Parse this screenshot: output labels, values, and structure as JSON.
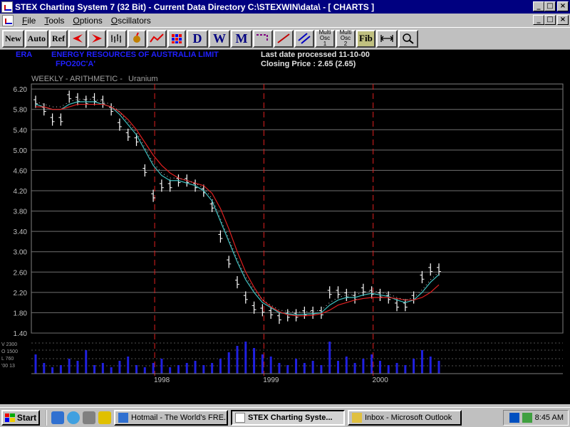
{
  "window": {
    "title": "STEX Charting System 7 (32 Bit)  -  Current Data Directory C:\\STEXWIN\\data\\ - [  CHARTS    ]",
    "min": "_",
    "max": "□",
    "close": "×"
  },
  "menu": [
    "File",
    "Tools",
    "Options",
    "Oscillators"
  ],
  "toolbar": {
    "new": "New",
    "auto": "Auto",
    "ref": "Ref",
    "d": "D",
    "w": "W",
    "m": "M",
    "multi1": "Multi Osc 1",
    "multi2": "Multi Osc 2",
    "fib": "Fib"
  },
  "header": {
    "code": "ERA",
    "company": "ENERGY RESOURCES OF AUSTRALIA LIMIT",
    "subcode": "FPO20C'A'",
    "last_date": "Last date processed 11-10-00",
    "closing": "Closing Price : 2.65  (2.65)",
    "mode": "WEEKLY - ARITHMETIC -",
    "sector": "Uranium"
  },
  "chart_data": {
    "type": "line",
    "title": "",
    "ylim": [
      1.4,
      6.3
    ],
    "yticks": [
      "6.20",
      "5.80",
      "5.40",
      "5.00",
      "4.60",
      "4.20",
      "3.80",
      "3.40",
      "3.00",
      "2.60",
      "2.20",
      "1.80",
      "1.40"
    ],
    "xticks": [
      "1998",
      "1999",
      "2000"
    ],
    "volume_labels": [
      "V 2300",
      "O 1500",
      "L 760",
      "'00 13"
    ],
    "series": [
      {
        "values": [
          5.95,
          5.8,
          5.6,
          5.6,
          6.05,
          6.0,
          5.95,
          6.0,
          5.95,
          5.8,
          5.5,
          5.3,
          5.2,
          4.6,
          4.1,
          4.3,
          4.3,
          4.4,
          4.4,
          4.3,
          4.2,
          3.9,
          3.3,
          2.8,
          2.4,
          2.1,
          1.9,
          1.85,
          1.8,
          1.7,
          1.75,
          1.75,
          1.8,
          1.8,
          1.8,
          2.2,
          2.2,
          2.15,
          2.1,
          2.25,
          2.2,
          2.15,
          2.1,
          1.95,
          1.95,
          2.1,
          2.5,
          2.65,
          2.65
        ],
        "color": "#ffffff"
      },
      {
        "values": [
          5.9,
          5.85,
          5.8,
          5.8,
          5.9,
          5.95,
          5.95,
          5.95,
          5.9,
          5.85,
          5.7,
          5.5,
          5.3,
          5.0,
          4.7,
          4.5,
          4.4,
          4.4,
          4.35,
          4.3,
          4.2,
          4.0,
          3.6,
          3.2,
          2.8,
          2.45,
          2.2,
          2.0,
          1.9,
          1.8,
          1.78,
          1.76,
          1.77,
          1.78,
          1.8,
          1.95,
          2.05,
          2.1,
          2.1,
          2.15,
          2.18,
          2.15,
          2.12,
          2.05,
          2.0,
          2.05,
          2.2,
          2.4,
          2.55
        ],
        "color": "#40c0c0"
      },
      {
        "values": [
          5.85,
          5.85,
          5.8,
          5.8,
          5.85,
          5.9,
          5.9,
          5.9,
          5.9,
          5.85,
          5.75,
          5.6,
          5.4,
          5.15,
          4.9,
          4.7,
          4.55,
          4.45,
          4.4,
          4.35,
          4.3,
          4.15,
          3.85,
          3.45,
          3.0,
          2.6,
          2.3,
          2.05,
          1.92,
          1.82,
          1.76,
          1.74,
          1.74,
          1.75,
          1.78,
          1.85,
          1.95,
          2.0,
          2.05,
          2.08,
          2.1,
          2.1,
          2.1,
          2.08,
          2.05,
          2.05,
          2.1,
          2.2,
          2.35
        ],
        "color": "#e02020"
      }
    ],
    "volume": [
      18,
      10,
      6,
      8,
      14,
      12,
      22,
      8,
      10,
      6,
      12,
      16,
      8,
      6,
      10,
      14,
      6,
      8,
      10,
      12,
      8,
      10,
      14,
      20,
      26,
      30,
      24,
      18,
      16,
      10,
      8,
      14,
      10,
      12,
      8,
      30,
      12,
      16,
      10,
      14,
      18,
      12,
      8,
      10,
      8,
      14,
      22,
      16,
      12
    ]
  },
  "taskbar": {
    "start": "Start",
    "tasks": [
      "Hotmail - The World's FRE...",
      "STEX Charting Syste...",
      "Inbox - Microsoft Outlook"
    ],
    "time": "8:45 AM"
  }
}
